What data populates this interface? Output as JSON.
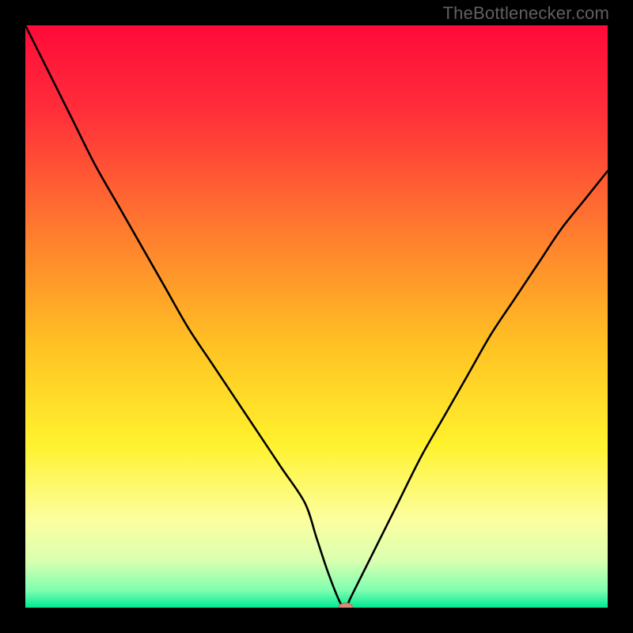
{
  "watermark": "TheBottlenecker.com",
  "colors": {
    "gradient_stops": [
      {
        "offset": 0.0,
        "color": "#ff0a3a"
      },
      {
        "offset": 0.15,
        "color": "#ff2f3a"
      },
      {
        "offset": 0.35,
        "color": "#ff7a2f"
      },
      {
        "offset": 0.55,
        "color": "#ffc223"
      },
      {
        "offset": 0.72,
        "color": "#fff22e"
      },
      {
        "offset": 0.85,
        "color": "#fcffa0"
      },
      {
        "offset": 0.92,
        "color": "#d9ffb0"
      },
      {
        "offset": 0.97,
        "color": "#7fffb0"
      },
      {
        "offset": 1.0,
        "color": "#00e893"
      }
    ],
    "curve": "#000000",
    "marker_fill": "#d98a7a",
    "marker_stroke": "#c06a5a",
    "frame": "#000000"
  },
  "chart_data": {
    "type": "line",
    "title": "",
    "xlabel": "",
    "ylabel": "",
    "xlim": [
      0,
      100
    ],
    "ylim": [
      0,
      100
    ],
    "x": [
      0,
      4,
      8,
      12,
      16,
      20,
      24,
      28,
      32,
      36,
      40,
      44,
      48,
      50,
      52,
      54,
      55,
      56,
      60,
      64,
      68,
      72,
      76,
      80,
      84,
      88,
      92,
      96,
      100
    ],
    "values": [
      100,
      92,
      84,
      76,
      69,
      62,
      55,
      48,
      42,
      36,
      30,
      24,
      18,
      12,
      6,
      1,
      0,
      2,
      10,
      18,
      26,
      33,
      40,
      47,
      53,
      59,
      65,
      70,
      75
    ],
    "marker": {
      "x": 55,
      "y": 0,
      "rx": 1.2,
      "ry": 0.8
    },
    "notes": "V-shaped bottleneck curve; minimum (ideal match) at x≈55. Left branch starts at 100%, right branch ends ≈75%."
  }
}
